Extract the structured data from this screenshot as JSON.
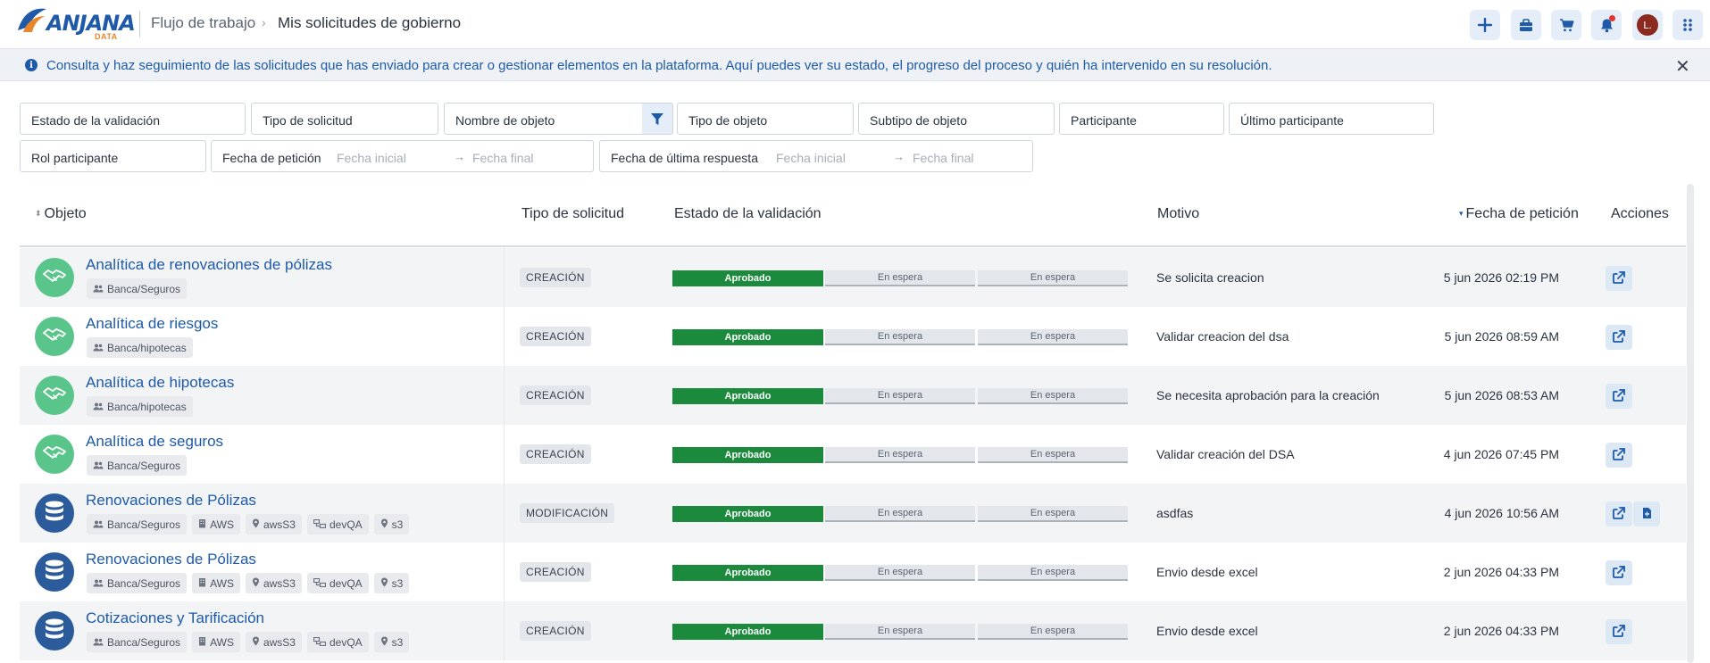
{
  "app": {
    "logo_text": "ANJANA",
    "logo_sub": "DATA"
  },
  "breadcrumb": {
    "parent": "Flujo de trabajo",
    "current": "Mis solicitudes de gobierno"
  },
  "header_actions": {
    "avatar_initial": "L.",
    "icons": [
      "plus-icon",
      "briefcase-icon",
      "cart-icon",
      "bell-icon",
      "apps-grid-icon"
    ]
  },
  "banner": {
    "text": "Consulta y haz seguimiento de las solicitudes que has enviado para crear o gestionar elementos en la plataforma. Aquí puedes ver su estado, el progreso del proceso y quién ha intervenido en su resolución."
  },
  "filters": {
    "estado_validacion": "Estado de la validación",
    "tipo_solicitud": "Tipo de solicitud",
    "nombre_objeto": "Nombre de objeto",
    "tipo_objeto": "Tipo de objeto",
    "subtipo_objeto": "Subtipo de objeto",
    "participante": "Participante",
    "ultimo_participante": "Último participante",
    "rol_participante": "Rol participante",
    "fecha_peticion": "Fecha de petición",
    "fecha_ultima_respuesta": "Fecha de última respuesta",
    "fecha_inicial": "Fecha inicial",
    "fecha_final": "Fecha final"
  },
  "columns": {
    "objeto": "Objeto",
    "tipo_solicitud": "Tipo de solicitud",
    "estado_validacion": "Estado de la validación",
    "motivo": "Motivo",
    "fecha_peticion": "Fecha de petición",
    "acciones": "Acciones"
  },
  "rows": [
    {
      "name": "Analítica de renovaciones de pólizas",
      "icon": "handshake-icon",
      "icon_color": "#5ac58a",
      "tags": [
        "Banca/Seguros"
      ],
      "type": "CREACIÓN",
      "steps": [
        "Aprobado",
        "En espera",
        "En espera"
      ],
      "motivo": "Se solicita creacion",
      "fecha": "5 jun 2026 02:19 PM",
      "extra_action": false
    },
    {
      "name": "Analítica de riesgos",
      "icon": "handshake-icon",
      "icon_color": "#5ac58a",
      "tags": [
        "Banca/hipotecas"
      ],
      "type": "CREACIÓN",
      "steps": [
        "Aprobado",
        "En espera",
        "En espera"
      ],
      "motivo": "Validar creacion del dsa",
      "fecha": "5 jun 2026 08:59 AM",
      "extra_action": false
    },
    {
      "name": "Analítica de hipotecas",
      "icon": "handshake-icon",
      "icon_color": "#5ac58a",
      "tags": [
        "Banca/hipotecas"
      ],
      "type": "CREACIÓN",
      "steps": [
        "Aprobado",
        "En espera",
        "En espera"
      ],
      "motivo": "Se necesita aprobación para la creación",
      "fecha": "5 jun 2026 08:53 AM",
      "extra_action": false
    },
    {
      "name": "Analítica de seguros",
      "icon": "handshake-icon",
      "icon_color": "#5ac58a",
      "tags": [
        "Banca/Seguros"
      ],
      "type": "CREACIÓN",
      "steps": [
        "Aprobado",
        "En espera",
        "En espera"
      ],
      "motivo": "Validar creación del DSA",
      "fecha": "4 jun 2026 07:45 PM",
      "extra_action": false
    },
    {
      "name": "Renovaciones de Pólizas",
      "icon": "database-icon",
      "icon_color": "#2c5b9c",
      "tags": [
        "Banca/Seguros",
        "AWS",
        "awsS3",
        "devQA",
        "s3"
      ],
      "type": "MODIFICACIÓN",
      "steps": [
        "Aprobado",
        "En espera",
        "En espera"
      ],
      "motivo": "asdfas",
      "fecha": "4 jun 2026 10:56 AM",
      "extra_action": true
    },
    {
      "name": "Renovaciones de Pólizas",
      "icon": "database-icon",
      "icon_color": "#2c5b9c",
      "tags": [
        "Banca/Seguros",
        "AWS",
        "awsS3",
        "devQA",
        "s3"
      ],
      "type": "CREACIÓN",
      "steps": [
        "Aprobado",
        "En espera",
        "En espera"
      ],
      "motivo": "Envio desde excel",
      "fecha": "2 jun 2026 04:33 PM",
      "extra_action": false
    },
    {
      "name": "Cotizaciones y Tarificación",
      "icon": "database-icon",
      "icon_color": "#2c5b9c",
      "tags": [
        "Banca/Seguros",
        "AWS",
        "awsS3",
        "devQA",
        "s3"
      ],
      "type": "CREACIÓN",
      "steps": [
        "Aprobado",
        "En espera",
        "En espera"
      ],
      "motivo": "Envio desde excel",
      "fecha": "2 jun 2026 04:33 PM",
      "extra_action": false
    }
  ],
  "tag_icons": [
    "group-icon",
    "building-icon",
    "location-icon",
    "network-icon",
    "location-icon"
  ]
}
